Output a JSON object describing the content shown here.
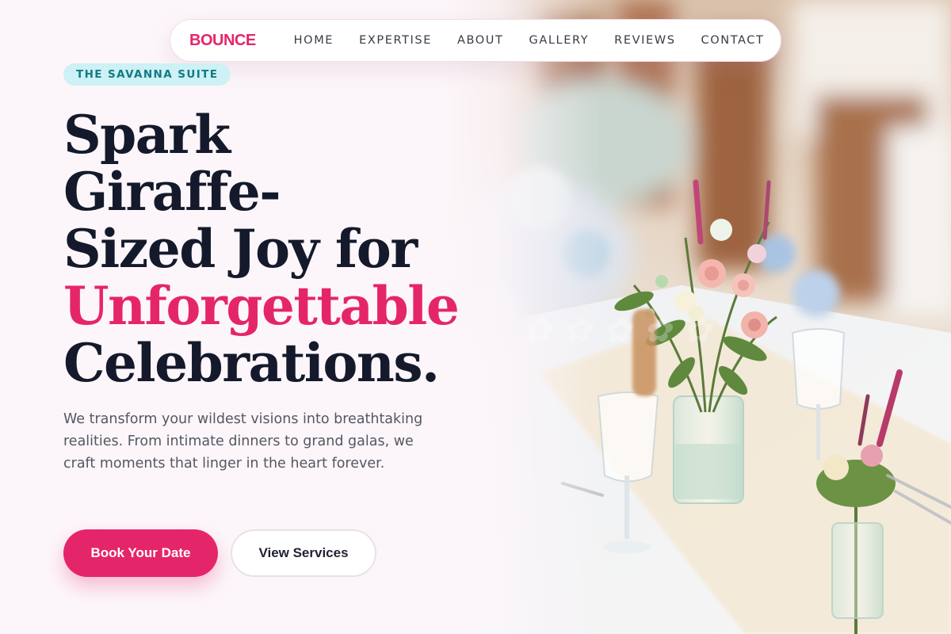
{
  "brand": "BOUNCE",
  "nav": [
    {
      "label": "HOME"
    },
    {
      "label": "EXPERTISE"
    },
    {
      "label": "ABOUT"
    },
    {
      "label": "GALLERY"
    },
    {
      "label": "REVIEWS"
    },
    {
      "label": "CONTACT"
    }
  ],
  "hero": {
    "badge": "THE SAVANNA SUITE",
    "headline": {
      "line1": "Spark",
      "line2": "Giraffe-",
      "line3": "Sized Joy for",
      "accent": "Unforgettable",
      "line5": "Celebrations."
    },
    "description": "We transform your wildest visions into breathtaking realities. From intimate dinners to grand galas, we craft moments that linger in the heart forever.",
    "primary_cta": "Book Your Date",
    "secondary_cta": "View Services"
  },
  "colors": {
    "accent": "#e5256a",
    "badge_bg": "#cdf1f4",
    "badge_text": "#127a86",
    "heading": "#141a2b",
    "background": "#fcf6fa"
  },
  "image": {
    "subject": "wedding-table-flowers-photo"
  }
}
